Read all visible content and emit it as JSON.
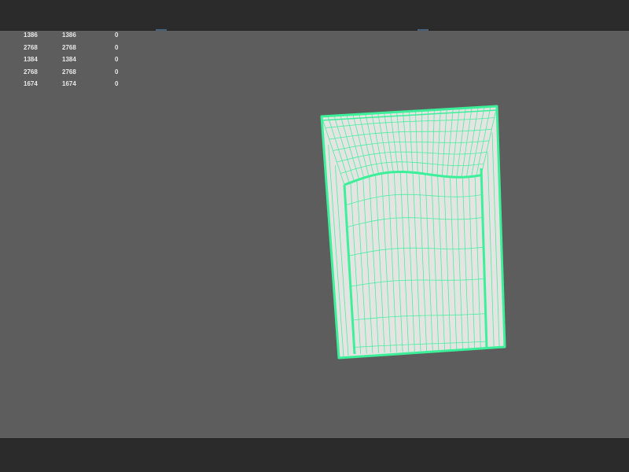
{
  "hud": {
    "rows": [
      {
        "a": "1386",
        "b": "1386",
        "c": "0"
      },
      {
        "a": "2768",
        "b": "2768",
        "c": "0"
      },
      {
        "a": "1384",
        "b": "1384",
        "c": "0"
      },
      {
        "a": "2768",
        "b": "2768",
        "c": "0"
      },
      {
        "a": "1674",
        "b": "1674",
        "c": "0"
      }
    ]
  },
  "colors": {
    "viewport_bg": "#5d5d5d",
    "wireframe": "#3cf09a",
    "surface": "#e4e4e2",
    "chrome": "#2b2b2b"
  }
}
